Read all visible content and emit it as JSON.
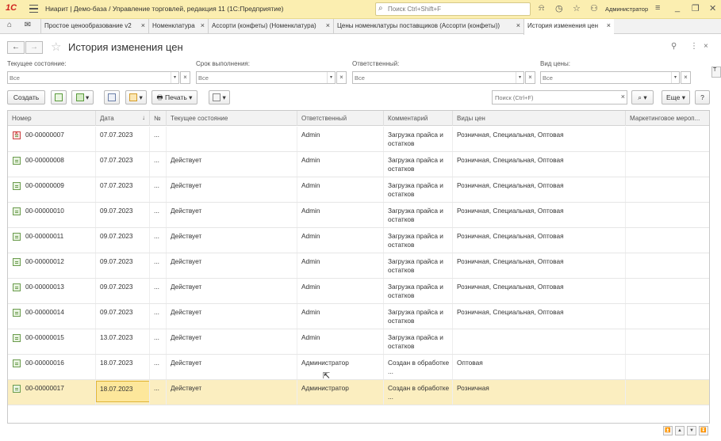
{
  "app": {
    "logo": "1С",
    "title": "Ниарит | Демо-база / Управление торговлей, редакция 11  (1С:Предприятие)",
    "search_placeholder": "Поиск Ctrl+Shift+F",
    "user": "Администратор"
  },
  "tabs": [
    {
      "label": "Простое ценообразование v2"
    },
    {
      "label": "Номенклатура"
    },
    {
      "label": "Ассорти (конфеты) (Номенклатура)"
    },
    {
      "label": "Цены номенклатуры поставщиков (Ассорти (конфеты))"
    },
    {
      "label": "История изменения цен"
    }
  ],
  "form": {
    "title": "История изменения цен"
  },
  "filters": {
    "state": {
      "label": "Текущее состояние:",
      "value": "Все"
    },
    "deadline": {
      "label": "Срок выполнения:",
      "value": "Все"
    },
    "responsible": {
      "label": "Ответственный:",
      "value": "Все"
    },
    "price_type": {
      "label": "Вид цены:",
      "value": "Все"
    }
  },
  "toolbar": {
    "create": "Создать",
    "print": "Печать",
    "search_placeholder": "Поиск (Ctrl+F)",
    "more": "Еще",
    "help": "?"
  },
  "table": {
    "columns": [
      "Номер",
      "Дата",
      "№",
      "Текущее состояние",
      "Ответственный",
      "Комментарий",
      "Виды цен",
      "Маркетинговое мероп..."
    ],
    "rows": [
      {
        "number": "00-00000007",
        "date": "07.07.2023",
        "n": "...",
        "state": "",
        "responsible": "Admin",
        "comment": "Загрузка прайса и остатков",
        "price_types": "Розничная, Специальная, Оптовая",
        "deleted": true
      },
      {
        "number": "00-00000008",
        "date": "07.07.2023",
        "n": "...",
        "state": "Действует",
        "responsible": "Admin",
        "comment": "Загрузка прайса и остатков",
        "price_types": "Розничная, Специальная, Оптовая"
      },
      {
        "number": "00-00000009",
        "date": "07.07.2023",
        "n": "...",
        "state": "Действует",
        "responsible": "Admin",
        "comment": "Загрузка прайса и остатков",
        "price_types": "Розничная, Специальная, Оптовая"
      },
      {
        "number": "00-00000010",
        "date": "09.07.2023",
        "n": "...",
        "state": "Действует",
        "responsible": "Admin",
        "comment": "Загрузка прайса и остатков",
        "price_types": "Розничная, Специальная, Оптовая"
      },
      {
        "number": "00-00000011",
        "date": "09.07.2023",
        "n": "...",
        "state": "Действует",
        "responsible": "Admin",
        "comment": "Загрузка прайса и остатков",
        "price_types": "Розничная, Специальная, Оптовая"
      },
      {
        "number": "00-00000012",
        "date": "09.07.2023",
        "n": "...",
        "state": "Действует",
        "responsible": "Admin",
        "comment": "Загрузка прайса и остатков",
        "price_types": "Розничная, Специальная, Оптовая"
      },
      {
        "number": "00-00000013",
        "date": "09.07.2023",
        "n": "...",
        "state": "Действует",
        "responsible": "Admin",
        "comment": "Загрузка прайса и остатков",
        "price_types": "Розничная, Специальная, Оптовая"
      },
      {
        "number": "00-00000014",
        "date": "09.07.2023",
        "n": "...",
        "state": "Действует",
        "responsible": "Admin",
        "comment": "Загрузка прайса и остатков",
        "price_types": "Розничная, Специальная, Оптовая"
      },
      {
        "number": "00-00000015",
        "date": "13.07.2023",
        "n": "...",
        "state": "Действует",
        "responsible": "Admin",
        "comment": "Загрузка прайса и остатков",
        "price_types": ""
      },
      {
        "number": "00-00000016",
        "date": "18.07.2023",
        "n": "...",
        "state": "Действует",
        "responsible": "Администратор",
        "comment": "Создан в обработке ...",
        "price_types": "Оптовая"
      },
      {
        "number": "00-00000017",
        "date": "18.07.2023",
        "n": "...",
        "state": "Действует",
        "responsible": "Администратор",
        "comment": "Создан в обработке ...",
        "price_types": "Розничная",
        "selected": true
      }
    ]
  },
  "colors": {
    "titlebar": "#fbeeb0",
    "selected_row": "#fbeec0",
    "active_cell": "#fde79b",
    "brand": "#d0231f"
  }
}
